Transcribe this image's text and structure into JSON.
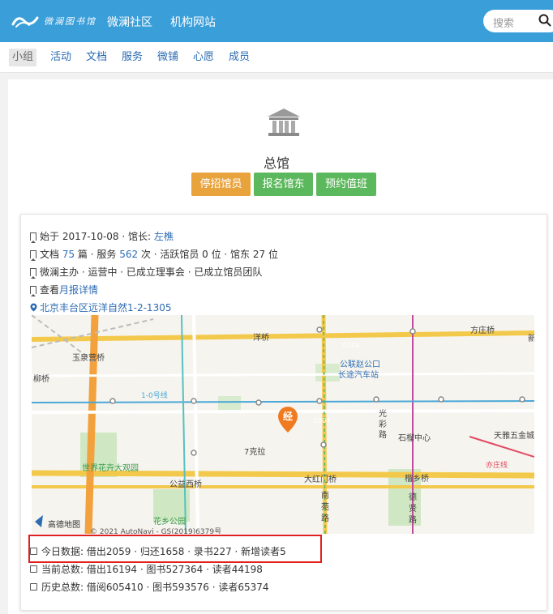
{
  "header": {
    "logo_text": "微澜图书馆",
    "nav": [
      "微澜社区",
      "机构网站"
    ],
    "search_placeholder": "搜索"
  },
  "subnav": {
    "items": [
      "小组",
      "活动",
      "文档",
      "服务",
      "微铺",
      "心愿",
      "成员"
    ],
    "active": "小组"
  },
  "group": {
    "title": "总馆",
    "buttons": [
      {
        "label": "停招馆员",
        "color": "#e8a33d"
      },
      {
        "label": "报名馆东",
        "color": "#5cb85c"
      },
      {
        "label": "预约值班",
        "color": "#5cb85c"
      }
    ]
  },
  "info": {
    "founded": "始于 2017-10-08 · 馆长: ",
    "leader": "左樵",
    "docs_prefix": "文档 ",
    "docs_count": "75",
    "docs_mid": " 篇 · 服务 ",
    "service_count": "562",
    "docs_suffix": " 次 · 活跃馆员 0 位 · 馆东 27 位",
    "status": "微澜主办 · 运营中 · 已成立理事会 · 已成立馆员团队",
    "monthly_prefix": "查看",
    "monthly_link": "月报详情",
    "address": "北京丰台区远洋自然1-2-1305"
  },
  "map": {
    "labels": [
      "洋桥",
      "方庄桥",
      "G104",
      "公联赵公口",
      "长途汽车站",
      "柳桥",
      "玉泉营桥",
      "1-0号线",
      "光",
      "彩",
      "路",
      "石榴中心",
      "天雅五金城",
      "7克拉",
      "G104",
      "世界花卉大观园",
      "亦庄线",
      "公益西桥",
      "大红门桥",
      "榴乡桥",
      "南",
      "苑",
      "路",
      "德",
      "贤",
      "路",
      "花乡公园",
      "高德地图",
      "© 2021 AutoNavi - GS(2019)6379号",
      "经",
      "新"
    ],
    "colors": {
      "water": "#7ec7e8",
      "road_major": "#f3c94c",
      "park": "#cfe8c3",
      "metro": "#4aa8d8",
      "marker": "#f07a1f"
    }
  },
  "stats": {
    "today": "今日数据: 借出2059 · 归还1658 · 录书227 · 新增读者5",
    "current": "当前总数: 借出16194 · 图书527364 · 读者44198",
    "history": "历史总数: 借阅605410 · 图书593576 · 读者65374"
  },
  "colors": {
    "topbar": "#3a9ed9",
    "link": "#2d6cb3",
    "highlight": "#e02020"
  }
}
